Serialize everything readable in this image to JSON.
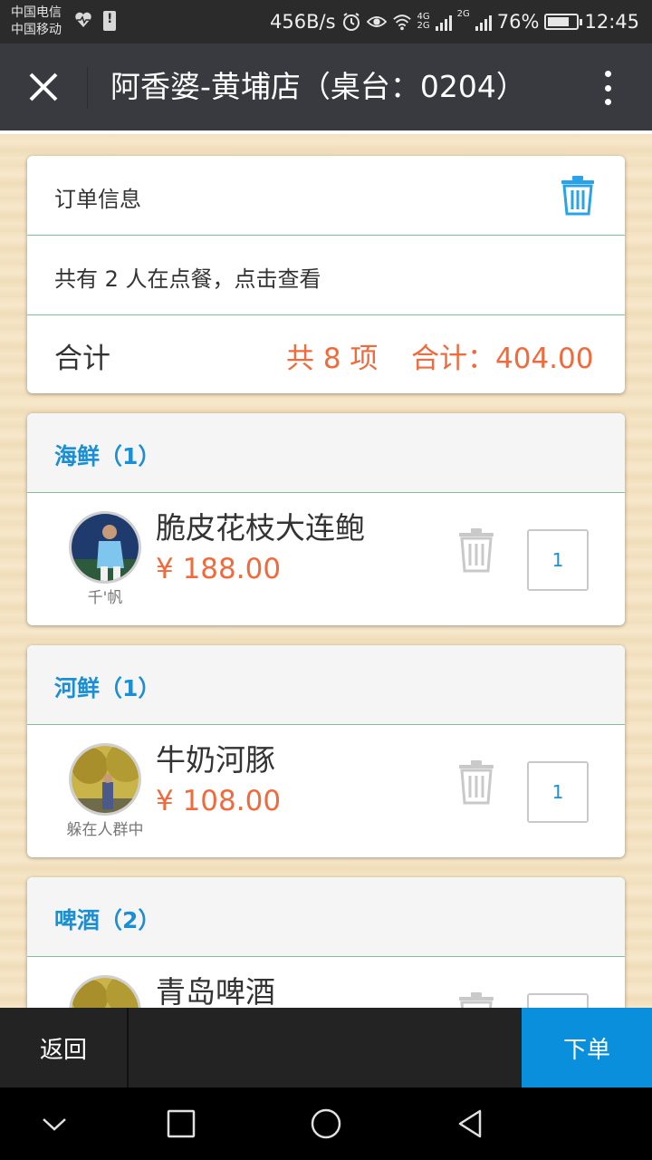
{
  "status_bar": {
    "carrier_1": "中国电信",
    "carrier_2": "中国移动",
    "net_speed": "456B/s",
    "network_1": "4G",
    "network_2": "2G",
    "network_3": "2G",
    "battery": "76%",
    "battery_level": 0.76,
    "time": "12:45"
  },
  "header": {
    "title": "阿香婆-黄埔店（桌台：0204）"
  },
  "order_info": {
    "title": "订单信息",
    "diners_text": "共有 2 人在点餐，点击查看",
    "total_label": "合计",
    "item_count_text": "共 8 项",
    "total_text": "合计：404.00"
  },
  "categories": [
    {
      "title": "海鲜（1）",
      "item": {
        "name": "脆皮花枝大连鲍",
        "price": "¥ 188.00",
        "user": "千'帆",
        "qty": "1"
      }
    },
    {
      "title": "河鲜（1）",
      "item": {
        "name": "牛奶河豚",
        "price": "¥ 108.00",
        "user": "躲在人群中",
        "qty": "1"
      }
    },
    {
      "title": "啤酒（2）",
      "item": {
        "name": "青岛啤酒",
        "price": "",
        "user": "",
        "qty": ""
      }
    }
  ],
  "footer": {
    "back_label": "返回",
    "order_label": "下单"
  },
  "colors": {
    "accent_blue": "#1a8fd6",
    "price_orange": "#f06a3c",
    "order_button": "#0a8fdc",
    "titlebar": "#393a3f"
  }
}
